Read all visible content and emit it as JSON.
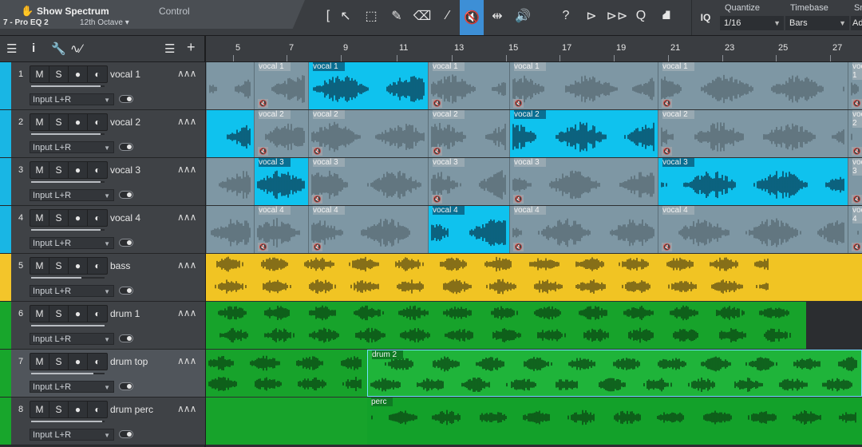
{
  "toolbar": {
    "show_spectrum": "Show Spectrum",
    "control_label": "Control",
    "plugin_name": "7 - Pro EQ 2",
    "octave": "12th Octave",
    "tools": [
      "[",
      "↖",
      "⬚",
      "✎",
      "⌫",
      "∕",
      "🔇",
      "⇹",
      "🔊",
      "?",
      "⊳",
      "⊳⊳",
      "Q",
      "⛘"
    ],
    "iq": "IQ",
    "quantize_label": "Quantize",
    "quantize_value": "1/16",
    "timebase_label": "Timebase",
    "timebase_value": "Bars",
    "snap_label": "Sn",
    "snap_value": "Ad"
  },
  "ruler": {
    "bars": [
      "5",
      "7",
      "9",
      "11",
      "13",
      "15",
      "17",
      "19",
      "21",
      "23",
      "25",
      "27"
    ]
  },
  "tracks": [
    {
      "number": "1",
      "name": "vocal 1",
      "input": "Input L+R",
      "color": "#19b6e4",
      "fader": 0.95
    },
    {
      "number": "2",
      "name": "vocal 2",
      "input": "Input L+R",
      "color": "#19b6e4",
      "fader": 0.95
    },
    {
      "number": "3",
      "name": "vocal 3",
      "input": "Input L+R",
      "color": "#19b6e4",
      "fader": 0.95
    },
    {
      "number": "4",
      "name": "vocal 4",
      "input": "Input L+R",
      "color": "#19b6e4",
      "fader": 0.95
    },
    {
      "number": "5",
      "name": "bass",
      "input": "Input L+R",
      "color": "#f3c52a",
      "fader": 0.68
    },
    {
      "number": "6",
      "name": "drum 1",
      "input": "Input L+R",
      "color": "#18a62c",
      "fader": 1.0
    },
    {
      "number": "7",
      "name": "drum top",
      "input": "Input L+R",
      "color": "#18a62c",
      "fader": 0.85
    },
    {
      "number": "8",
      "name": "drum perc",
      "input": "Input L+R",
      "color": "#18a62c",
      "fader": 0.97
    }
  ],
  "buttons": {
    "mute": "M",
    "solo": "S"
  },
  "event_labels": {
    "vocal1": "vocal 1",
    "vocal2": "vocal 2",
    "vocal3": "vocal 3",
    "vocal4": "vocal 4",
    "drum2": "drum 2",
    "perc": "perc"
  }
}
